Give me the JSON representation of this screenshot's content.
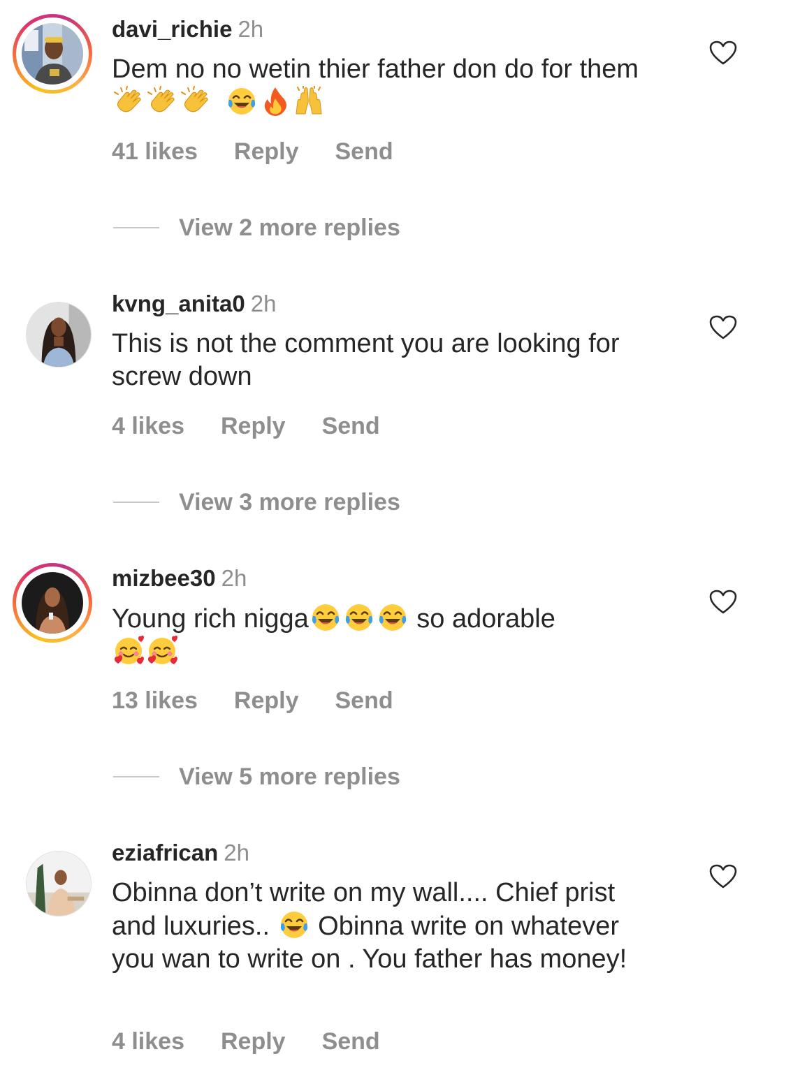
{
  "comments": [
    {
      "username": "davi_richie",
      "time": "2h",
      "text_part1": "Dem no no wetin thier father don do for them ",
      "emojis": [
        "clapping-hands",
        "clapping-hands",
        "clapping-hands",
        "tears-of-joy",
        "fire",
        "raising-hands"
      ],
      "likes": "41 likes",
      "reply": "Reply",
      "send": "Send",
      "view_replies": "View 2 more replies",
      "has_story_ring": true
    },
    {
      "username": "kvng_anita0",
      "time": "2h",
      "text": "This is not the comment you are looking for screw down",
      "likes": "4 likes",
      "reply": "Reply",
      "send": "Send",
      "view_replies": "View 3 more replies",
      "has_story_ring": false
    },
    {
      "username": "mizbee30",
      "time": "2h",
      "text_part1": "Young rich nigga",
      "text_part2": " so adorable",
      "emojis_mid": [
        "tears-of-joy",
        "tears-of-joy",
        "tears-of-joy"
      ],
      "emojis_end": [
        "smiling-face-with-hearts",
        "smiling-face-with-hearts"
      ],
      "likes": "13 likes",
      "reply": "Reply",
      "send": "Send",
      "view_replies": "View 5 more replies",
      "has_story_ring": true
    },
    {
      "username": "eziafrican",
      "time": "2h",
      "text_part1": "Obinna don’t write on my wall.... Chief prist and luxuries.. ",
      "text_part2": " Obinna write on whatever you wan to write on . You father has money!",
      "emojis_mid": [
        "tears-of-joy"
      ],
      "likes": "4 likes",
      "reply": "Reply",
      "send": "Send",
      "has_story_ring": false
    }
  ],
  "colors": {
    "text": "#262626",
    "secondary": "#8e8e8e",
    "divider": "#c7c7c7"
  }
}
